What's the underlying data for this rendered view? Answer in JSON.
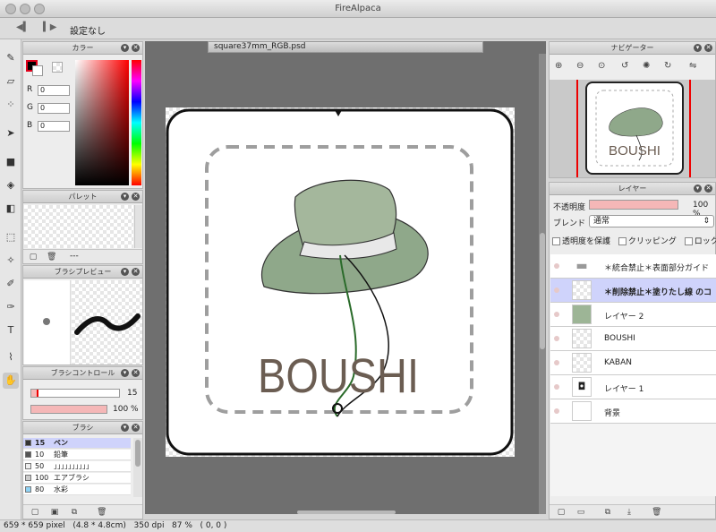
{
  "window": {
    "title": "FireAlpaca"
  },
  "toolbar": {
    "selection_label": "設定なし"
  },
  "color_panel": {
    "title": "カラー",
    "r_label": "R",
    "g_label": "G",
    "b_label": "B",
    "r": "0",
    "g": "0",
    "b": "0",
    "primary_color": "#000000",
    "accent_red": "#e0001a"
  },
  "palette_panel": {
    "title": "パレット",
    "footer_text": "---"
  },
  "brush_preview_panel": {
    "title": "ブラシプレビュー"
  },
  "brush_control_panel": {
    "title": "ブラシコントロール",
    "size": "15",
    "opacity": "100 %",
    "opacity_fraction": 1.0,
    "size_fraction": 0.08
  },
  "brush_panel": {
    "title": "ブラシ",
    "items": [
      {
        "size": "15",
        "name": "ペン",
        "selected": true,
        "swatch": "#333333"
      },
      {
        "size": "10",
        "name": "鉛筆",
        "selected": false,
        "swatch": "#555555"
      },
      {
        "size": "50",
        "name": "」」」」」」」」」」",
        "selected": false,
        "swatch": "#eeeeee"
      },
      {
        "size": "100",
        "name": "エアブラシ",
        "selected": false,
        "swatch": "#cccccc"
      },
      {
        "size": "80",
        "name": "水彩",
        "selected": false,
        "swatch": "#8fd3f5"
      }
    ]
  },
  "document": {
    "tab_title": "square37mm_RGB.psd",
    "artwork_text": "BOUSHI"
  },
  "navigator_panel": {
    "title": "ナビゲーター",
    "preview_text": "BOUSHI"
  },
  "layer_panel": {
    "title": "レイヤー",
    "opacity_label": "不透明度",
    "opacity_value": "100 %",
    "blend_label": "ブレンド",
    "blend_value": "通常",
    "protect_alpha_label": "透明度を保護",
    "clipping_label": "クリッピング",
    "lock_label": "ロック",
    "layers": [
      {
        "name": "＊統合禁止＊表面部分ガイド",
        "kind": "folder",
        "selected": false
      },
      {
        "name": "＊削除禁止＊塗りたし線 のコ",
        "kind": "layer",
        "selected": true
      },
      {
        "name": "レイヤー 2",
        "kind": "hat",
        "selected": false
      },
      {
        "name": "BOUSHI",
        "kind": "layer",
        "selected": false
      },
      {
        "name": "KABAN",
        "kind": "layer",
        "selected": false
      },
      {
        "name": "レイヤー 1",
        "kind": "bag",
        "selected": false
      },
      {
        "name": "背景",
        "kind": "white",
        "selected": false
      }
    ]
  },
  "status_bar": {
    "text": "659 * 659 pixel   (4.8 * 4.8cm)   350 dpi   87 %   ( 0, 0 )"
  }
}
